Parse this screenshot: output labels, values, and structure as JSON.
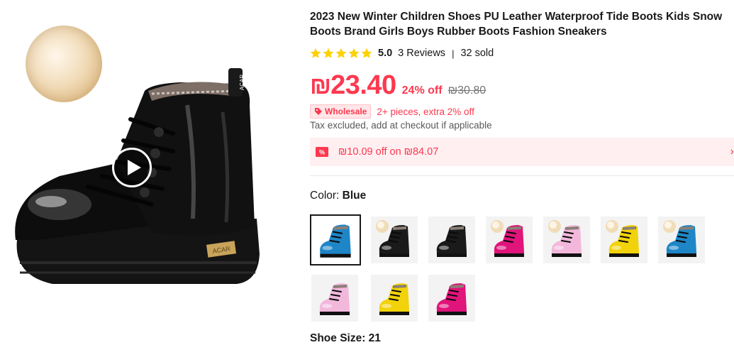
{
  "product": {
    "title": "2023 New Winter Children Shoes PU Leather Waterproof Tide Boots Kids Snow Boots Brand Girls Boys Rubber Boots Fashion Sneakers",
    "rating": {
      "stars": 5,
      "score": "5.0",
      "reviews": "3 Reviews",
      "separator": "|",
      "sold": "32 sold"
    },
    "price": {
      "currency": "₪",
      "amount": "23.40",
      "discount": "24% off",
      "original": "₪30.80"
    },
    "wholesale": {
      "badge": "Wholesale",
      "text": "2+ pieces, extra 2% off"
    },
    "tax_note": "Tax excluded, add at checkout if applicable",
    "coupon": {
      "text": "₪10.09 off on ₪84.07",
      "arrow": "›"
    },
    "color": {
      "label": "Color: ",
      "selected": "Blue",
      "options": [
        {
          "color": "#1e86c6",
          "fur": false
        },
        {
          "color": "#1a1a1a",
          "fur": true
        },
        {
          "color": "#1a1a1a",
          "fur": false
        },
        {
          "color": "#e0147a",
          "fur": true
        },
        {
          "color": "#f2b8dc",
          "fur": true
        },
        {
          "color": "#f2d20a",
          "fur": true
        },
        {
          "color": "#1e86c6",
          "fur": true
        },
        {
          "color": "#f2b8dc",
          "fur": false
        },
        {
          "color": "#f2d20a",
          "fur": false
        },
        {
          "color": "#e0147a",
          "fur": false
        }
      ]
    },
    "size_label": "Shoe Size: 21"
  },
  "colors": {
    "accent": "#fd384f",
    "star": "#fdd106"
  }
}
